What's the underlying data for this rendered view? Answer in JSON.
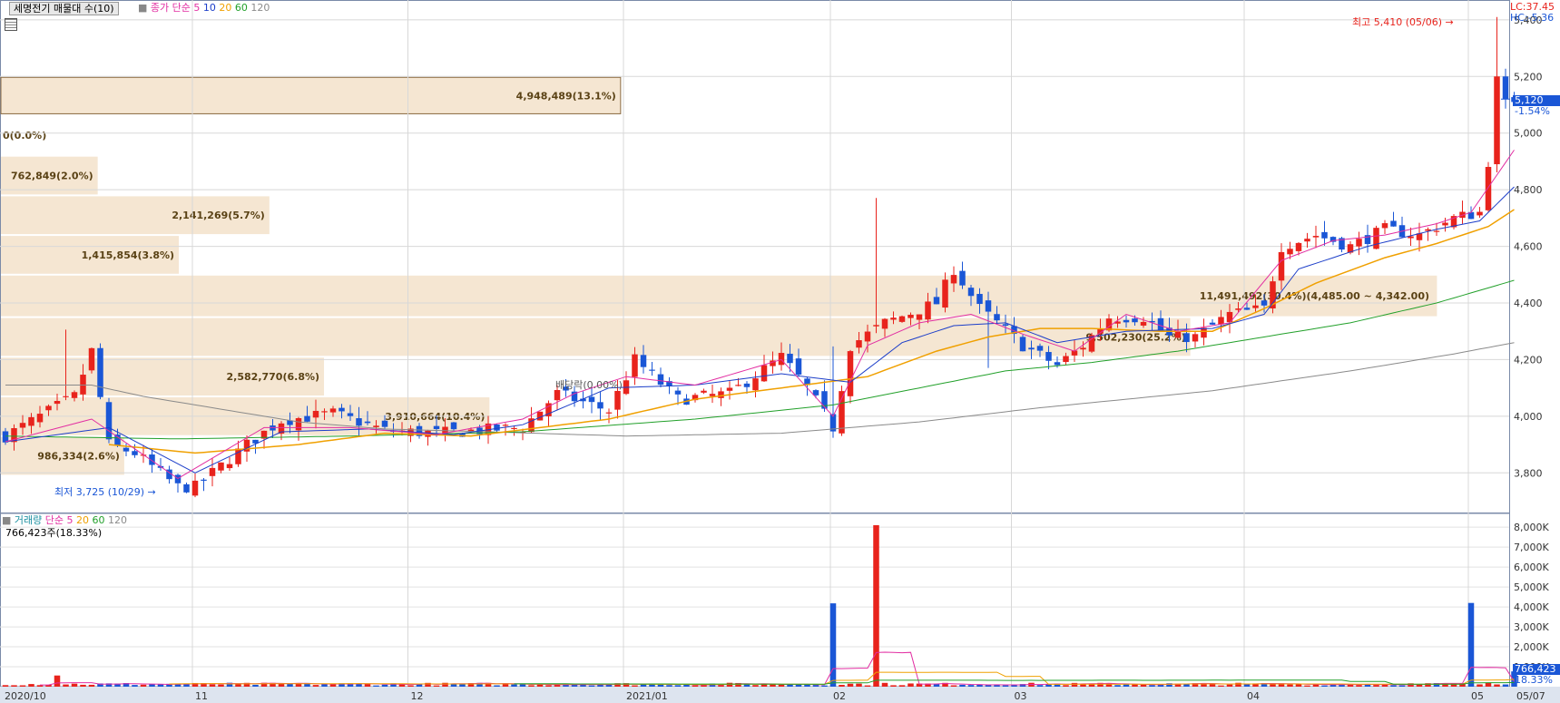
{
  "header": {
    "indicator_title": "세명전기 매물대 수(10)",
    "price_ma": {
      "label": "종가 단순",
      "periods": [
        "5",
        "10",
        "20",
        "60",
        "120"
      ]
    },
    "lc": "LC:37.45",
    "hc": "HC:-5.36"
  },
  "current": {
    "price": "5,120",
    "change": "-1.54%"
  },
  "annotations": {
    "high": "최고 5,410 (05/06) →",
    "low": "최저 3,725 (10/29) →",
    "dividend": "배당락(0.00%)"
  },
  "volume_panel": {
    "label": "거래량",
    "ma_label": "단순",
    "periods": [
      "5",
      "20",
      "60",
      "120"
    ],
    "current_text": "766,423주(18.33%)",
    "current_tag": "766,423",
    "current_pct": "18.33%"
  },
  "colors": {
    "up": "#e8231c",
    "down": "#1a56d6",
    "ma5": "#e22ea2",
    "ma10": "#1c3ec9",
    "ma20": "#f0a000",
    "ma60": "#22a02a",
    "ma120": "#8a8a8a",
    "profile": "#f5e6d2"
  },
  "chart_data": {
    "type": "candlestick",
    "ylim": [
      3660,
      5470
    ],
    "y_ticks": [
      3800,
      4000,
      4200,
      4400,
      4600,
      4800,
      5000,
      5200,
      5400
    ],
    "y_tick_labels": [
      "3,800",
      "4,000",
      "4,200",
      "4,400",
      "4,600",
      "4,800",
      "5,000",
      "5,200",
      "5,400"
    ],
    "x_ticks": [
      {
        "label": "2020/10",
        "i": 0
      },
      {
        "label": "11",
        "i": 22
      },
      {
        "label": "12",
        "i": 47
      },
      {
        "label": "2021/01",
        "i": 72
      },
      {
        "label": "02",
        "i": 96
      },
      {
        "label": "03",
        "i": 117
      },
      {
        "label": "04",
        "i": 144
      },
      {
        "label": "05",
        "i": 170
      },
      {
        "label": "05/07",
        "i": 175
      }
    ],
    "n": 176,
    "ohlc_anchors": [
      [
        0,
        3930
      ],
      [
        8,
        4070
      ],
      [
        10,
        4230
      ],
      [
        12,
        3900
      ],
      [
        15,
        3870
      ],
      [
        20,
        3750
      ],
      [
        22,
        3750
      ],
      [
        28,
        3900
      ],
      [
        32,
        3985
      ],
      [
        38,
        4010
      ],
      [
        44,
        3950
      ],
      [
        50,
        3940
      ],
      [
        55,
        3950
      ],
      [
        60,
        3960
      ],
      [
        64,
        4080
      ],
      [
        70,
        4020
      ],
      [
        73,
        4200
      ],
      [
        78,
        4060
      ],
      [
        84,
        4080
      ],
      [
        90,
        4210
      ],
      [
        93,
        4100
      ],
      [
        96,
        3960
      ],
      [
        98,
        4250
      ],
      [
        102,
        4330
      ],
      [
        108,
        4400
      ],
      [
        110,
        4520
      ],
      [
        113,
        4380
      ],
      [
        115,
        4330
      ],
      [
        118,
        4250
      ],
      [
        122,
        4180
      ],
      [
        125,
        4250
      ],
      [
        128,
        4350
      ],
      [
        132,
        4350
      ],
      [
        135,
        4280
      ],
      [
        138,
        4280
      ],
      [
        142,
        4360
      ],
      [
        146,
        4380
      ],
      [
        148,
        4600
      ],
      [
        152,
        4640
      ],
      [
        156,
        4600
      ],
      [
        160,
        4660
      ],
      [
        164,
        4640
      ],
      [
        168,
        4700
      ],
      [
        171,
        4720
      ],
      [
        172,
        4900
      ],
      [
        173,
        5200
      ],
      [
        174,
        5120
      ]
    ],
    "ma5_anchors": [
      [
        0,
        3910
      ],
      [
        10,
        3990
      ],
      [
        20,
        3780
      ],
      [
        30,
        3960
      ],
      [
        40,
        3960
      ],
      [
        50,
        3935
      ],
      [
        60,
        3990
      ],
      [
        66,
        4080
      ],
      [
        72,
        4140
      ],
      [
        80,
        4110
      ],
      [
        90,
        4200
      ],
      [
        96,
        4000
      ],
      [
        100,
        4250
      ],
      [
        106,
        4330
      ],
      [
        112,
        4360
      ],
      [
        118,
        4290
      ],
      [
        124,
        4230
      ],
      [
        130,
        4360
      ],
      [
        136,
        4300
      ],
      [
        142,
        4330
      ],
      [
        148,
        4550
      ],
      [
        154,
        4620
      ],
      [
        160,
        4640
      ],
      [
        166,
        4680
      ],
      [
        170,
        4720
      ],
      [
        175,
        4940
      ]
    ],
    "ma10_anchors": [
      [
        0,
        3910
      ],
      [
        12,
        3960
      ],
      [
        22,
        3800
      ],
      [
        32,
        3945
      ],
      [
        42,
        3955
      ],
      [
        52,
        3935
      ],
      [
        60,
        3970
      ],
      [
        70,
        4100
      ],
      [
        80,
        4110
      ],
      [
        90,
        4150
      ],
      [
        98,
        4120
      ],
      [
        104,
        4260
      ],
      [
        110,
        4320
      ],
      [
        116,
        4330
      ],
      [
        122,
        4260
      ],
      [
        130,
        4300
      ],
      [
        140,
        4310
      ],
      [
        146,
        4360
      ],
      [
        150,
        4520
      ],
      [
        158,
        4600
      ],
      [
        166,
        4660
      ],
      [
        171,
        4690
      ],
      [
        175,
        4810
      ]
    ],
    "ma20_anchors": [
      [
        12,
        3900
      ],
      [
        22,
        3870
      ],
      [
        34,
        3900
      ],
      [
        44,
        3940
      ],
      [
        54,
        3930
      ],
      [
        62,
        3960
      ],
      [
        70,
        3990
      ],
      [
        80,
        4060
      ],
      [
        90,
        4100
      ],
      [
        100,
        4140
      ],
      [
        108,
        4230
      ],
      [
        114,
        4280
      ],
      [
        120,
        4310
      ],
      [
        126,
        4310
      ],
      [
        134,
        4300
      ],
      [
        140,
        4300
      ],
      [
        146,
        4380
      ],
      [
        152,
        4470
      ],
      [
        160,
        4560
      ],
      [
        166,
        4610
      ],
      [
        172,
        4670
      ],
      [
        175,
        4730
      ]
    ],
    "ma60_anchors": [
      [
        0,
        3930
      ],
      [
        20,
        3920
      ],
      [
        40,
        3930
      ],
      [
        60,
        3945
      ],
      [
        80,
        3990
      ],
      [
        96,
        4040
      ],
      [
        106,
        4100
      ],
      [
        116,
        4160
      ],
      [
        126,
        4190
      ],
      [
        136,
        4230
      ],
      [
        146,
        4280
      ],
      [
        156,
        4330
      ],
      [
        166,
        4400
      ],
      [
        175,
        4480
      ]
    ],
    "ma120_anchors": [
      [
        0,
        4110
      ],
      [
        10,
        4110
      ],
      [
        16,
        4070
      ],
      [
        24,
        4030
      ],
      [
        34,
        3980
      ],
      [
        44,
        3955
      ],
      [
        56,
        3945
      ],
      [
        72,
        3930
      ],
      [
        90,
        3940
      ],
      [
        106,
        3980
      ],
      [
        120,
        4030
      ],
      [
        140,
        4090
      ],
      [
        156,
        4160
      ],
      [
        168,
        4220
      ],
      [
        175,
        4260
      ]
    ],
    "vol_ylim": [
      0,
      8600
    ],
    "vol_ticks": [
      1000,
      2000,
      3000,
      4000,
      5000,
      6000,
      7000,
      8000
    ],
    "vol_tick_labels": [
      "1,000K",
      "2,000K",
      "3,000K",
      "4,000K",
      "5,000K",
      "6,000K",
      "7,000K",
      "8,000K"
    ],
    "vol_spikes": [
      [
        6,
        560
      ],
      [
        96,
        4180
      ],
      [
        101,
        8100
      ],
      [
        170,
        4200
      ],
      [
        175,
        766
      ]
    ],
    "volume_profile": [
      {
        "price_lo": 5065,
        "price_hi": 5200,
        "label": "4,948,489(13.1%)",
        "frac": 0.397
      },
      {
        "price_lo": 4920,
        "price_hi": 5065,
        "label": "0(0.0%)",
        "frac": 0.0
      },
      {
        "price_lo": 4780,
        "price_hi": 4920,
        "label": "762,849(2.0%)",
        "frac": 0.062
      },
      {
        "price_lo": 4640,
        "price_hi": 4780,
        "label": "2,141,269(5.7%)",
        "frac": 0.172
      },
      {
        "price_lo": 4500,
        "price_hi": 4640,
        "label": "1,415,854(3.8%)",
        "frac": 0.114
      },
      {
        "price_lo": 4350,
        "price_hi": 4500,
        "label": "11,491,492(30.4%)(4,485.00 ~ 4,342.00)",
        "frac": 0.92
      },
      {
        "price_lo": 4210,
        "price_hi": 4350,
        "label": "9,502,230(25.2%)",
        "frac": 0.762
      },
      {
        "price_lo": 4070,
        "price_hi": 4210,
        "label": "2,582,770(6.8%)",
        "frac": 0.207
      },
      {
        "price_lo": 3930,
        "price_hi": 4070,
        "label": "3,910,664(10.4%)",
        "frac": 0.313
      },
      {
        "price_lo": 3790,
        "price_hi": 3930,
        "label": "986,334(2.6%)",
        "frac": 0.079
      }
    ]
  }
}
